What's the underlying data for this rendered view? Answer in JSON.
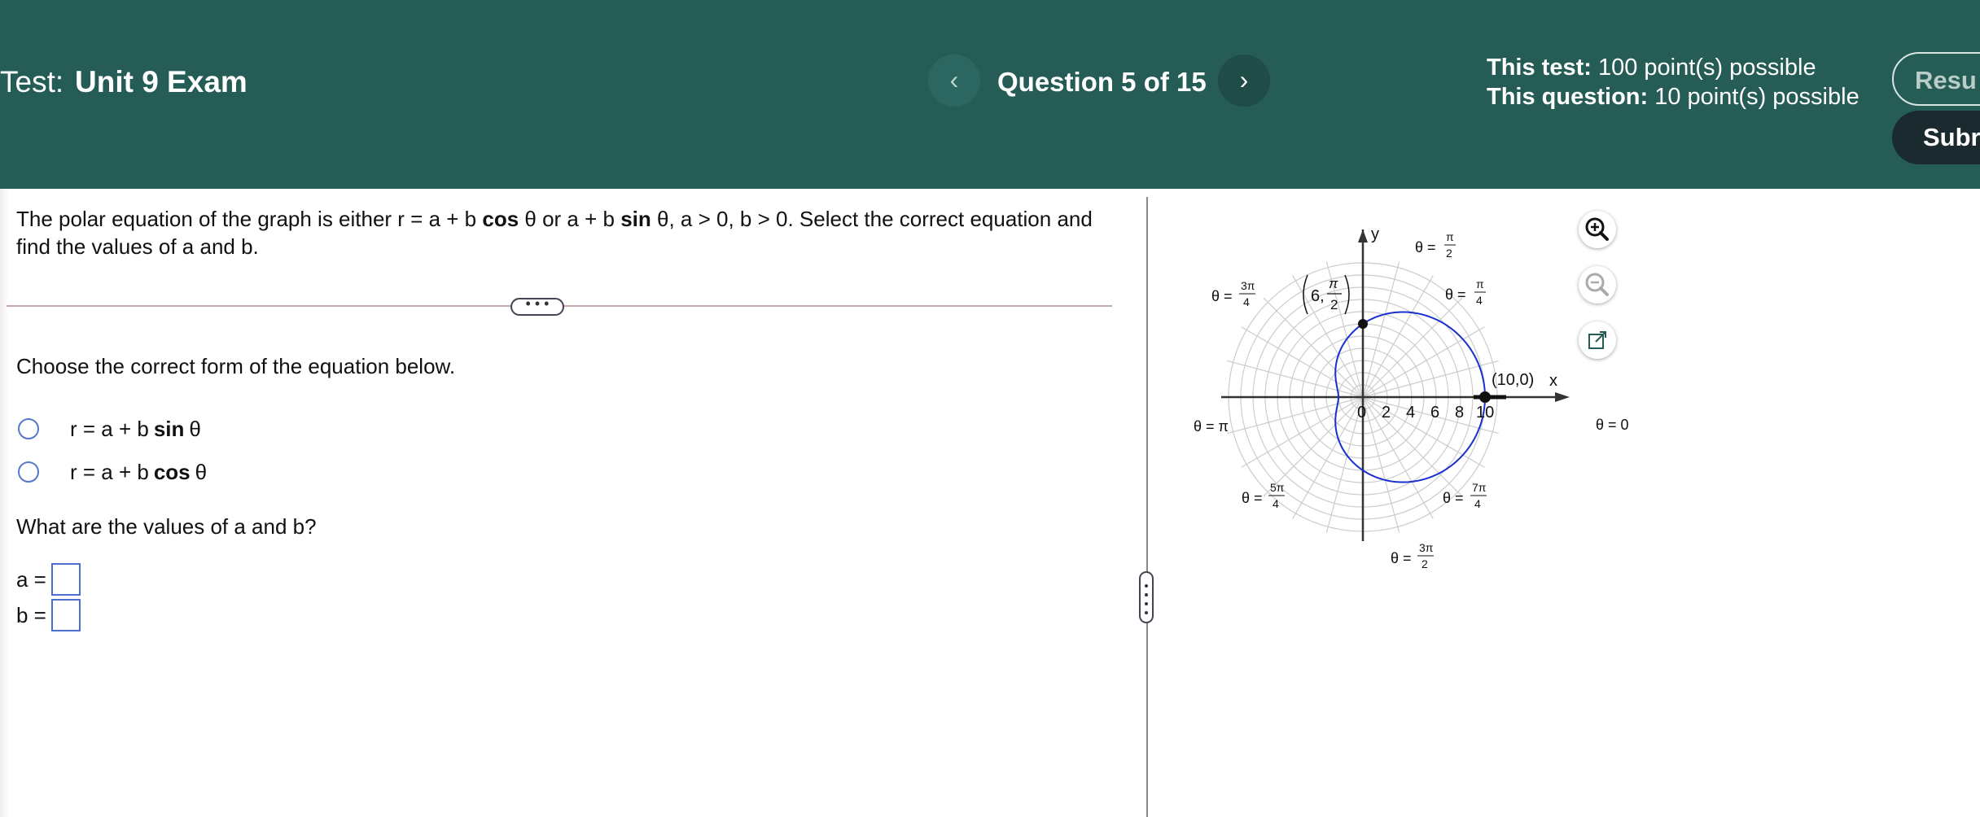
{
  "header": {
    "test_prefix": "Test:",
    "test_name": "Unit 9 Exam",
    "prev_icon": "‹",
    "question_counter": "Question 5 of 15",
    "next_icon": "›",
    "this_test_label": "This test:",
    "this_test_value": "100 point(s) possible",
    "this_question_label": "This question:",
    "this_question_value": "10 point(s) possible",
    "results_label": "Resu",
    "submit_label": "Subr"
  },
  "prompt": {
    "part1": "The polar equation of the graph is either r = a + b ",
    "cos_word": "cos",
    "part2": " θ or a + b ",
    "sin_word": "sin",
    "part3": " θ, a > 0, b > 0. Select the correct equation and find the values of a and b."
  },
  "expand_label": "• • •",
  "choose_label": "Choose the correct form of the equation below.",
  "choices": [
    {
      "pre": "r = a + b",
      "fn": "sin",
      "post": "θ",
      "selected": false
    },
    {
      "pre": "r = a + b",
      "fn": "cos",
      "post": "θ",
      "selected": false
    }
  ],
  "values_label": "What are the values of a and b?",
  "answers": [
    {
      "label": "a =",
      "value": ""
    },
    {
      "label": "b =",
      "value": ""
    }
  ],
  "tools": [
    {
      "name": "zoom-in-icon"
    },
    {
      "name": "zoom-out-icon"
    },
    {
      "name": "popout-icon"
    }
  ],
  "graph": {
    "axis_x_label": "x",
    "axis_y_label": "y",
    "tick_labels": [
      "0",
      "2",
      "4",
      "6",
      "8",
      "10"
    ],
    "point_label_top": "6,",
    "point_label_pi": "π",
    "point_label_2": "2",
    "point_label_right": "(10,0)",
    "theta_prefix": "θ =",
    "theta_0": "θ = 0",
    "theta_pi": "θ = π",
    "frac_pi_2": {
      "num": "π",
      "den": "2"
    },
    "frac_pi_4": {
      "num": "π",
      "den": "4"
    },
    "frac_3pi_4": {
      "num": "3π",
      "den": "4"
    },
    "frac_5pi_4": {
      "num": "5π",
      "den": "4"
    },
    "frac_3pi_2": {
      "num": "3π",
      "den": "2"
    },
    "frac_7pi_4": {
      "num": "7π",
      "den": "4"
    },
    "curve_color": "#1a2fd0",
    "grid_color": "#cccccc",
    "accent": "#255c55"
  }
}
